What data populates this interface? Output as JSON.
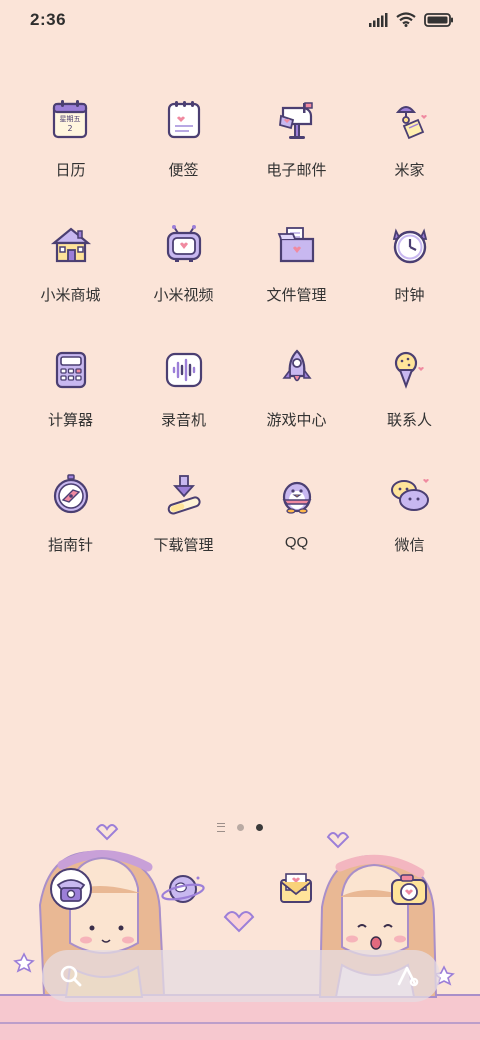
{
  "status": {
    "time": "2:36"
  },
  "apps": [
    {
      "label": "日历",
      "icon": "calendar-icon",
      "calendar_weekday": "星期五",
      "calendar_day": "2"
    },
    {
      "label": "便签",
      "icon": "notes-icon"
    },
    {
      "label": "电子邮件",
      "icon": "mailbox-icon"
    },
    {
      "label": "米家",
      "icon": "mijia-icon"
    },
    {
      "label": "小米商城",
      "icon": "house-store-icon"
    },
    {
      "label": "小米视频",
      "icon": "tv-icon"
    },
    {
      "label": "文件管理",
      "icon": "folder-box-icon"
    },
    {
      "label": "时钟",
      "icon": "clock-icon"
    },
    {
      "label": "计算器",
      "icon": "calculator-icon"
    },
    {
      "label": "录音机",
      "icon": "recorder-icon"
    },
    {
      "label": "游戏中心",
      "icon": "rocket-icon"
    },
    {
      "label": "联系人",
      "icon": "icecream-icon"
    },
    {
      "label": "指南针",
      "icon": "compass-icon"
    },
    {
      "label": "下载管理",
      "icon": "download-icon"
    },
    {
      "label": "QQ",
      "icon": "penguin-icon"
    },
    {
      "label": "微信",
      "icon": "chat-bubbles-icon"
    }
  ],
  "dock": [
    {
      "name": "phone",
      "icon": "telephone-icon"
    },
    {
      "name": "browser",
      "icon": "planet-icon"
    },
    {
      "name": "messages",
      "icon": "envelope-icon"
    },
    {
      "name": "camera",
      "icon": "camera-icon"
    }
  ],
  "pager": {
    "pages": 2,
    "current": 2
  },
  "colors": {
    "background": "#fbe4d8",
    "accent": "#9c7fd8",
    "heart": "#f08aa0",
    "outline": "#4b3f72"
  }
}
